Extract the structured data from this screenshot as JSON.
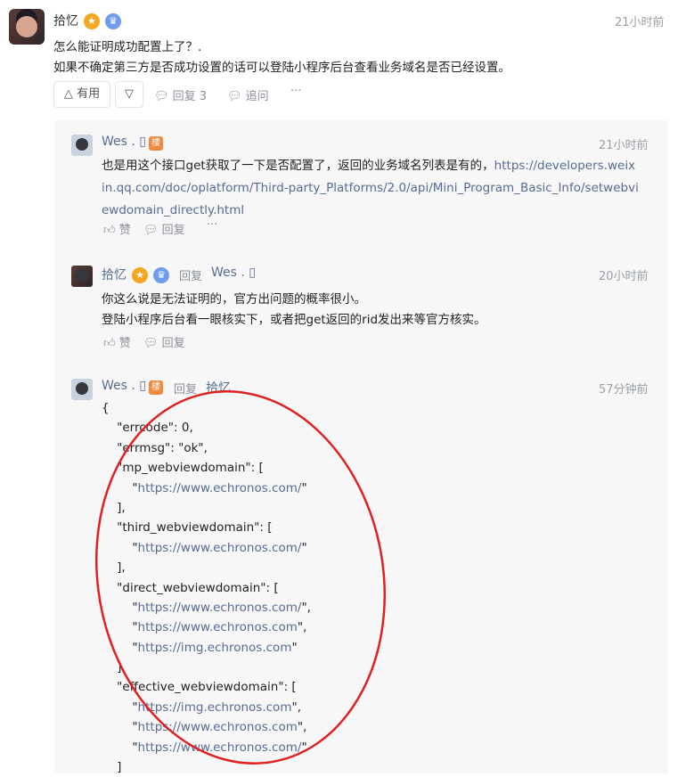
{
  "top": {
    "author": "拾忆",
    "time": "21小时前",
    "line1": "怎么能证明成功配置上了？.",
    "line2": "如果不确定第三方是否成功设置的话可以登陆小程序后台查看业务域名是否已经设置。",
    "useful_label": "有用",
    "reply_label": "回复 3",
    "followup_label": "追问",
    "more_label": "···"
  },
  "replies": [
    {
      "author": "Wes . ▯",
      "badge": "楼",
      "time": "21小时前",
      "text_prefix": "也是用这个接口get获取了一下是否配置了，返回的业务域名列表是有的，",
      "link_line1": "https://developers.weix",
      "link_line2": "in.qq.com/doc/oplatform/Third-party_Platforms/2.0/api/Mini_Program_Basic_Info/setwebvi",
      "link_line3": "ewdomain_directly.html",
      "like_label": "赞",
      "reply_label": "回复",
      "more_label": "···"
    },
    {
      "author": "拾忆",
      "reply_word": "回复",
      "reply_to": "Wes . ▯",
      "time": "20小时前",
      "line1": "你这么说是无法证明的，官方出问题的概率很小。",
      "line2": "登陆小程序后台看一眼核实下，或者把get返回的rid发出来等官方核实。",
      "like_label": "赞",
      "reply_label": "回复"
    },
    {
      "author": "Wes . ▯",
      "badge": "楼",
      "reply_word": "回复",
      "reply_to": "拾忆",
      "time": "57分钟前",
      "code_lines": [
        "{",
        "    \"errcode\": 0,",
        "    \"errmsg\": \"ok\",",
        "    \"mp_webviewdomain\": [",
        "        \"https://www.echronos.com/\"",
        "    ],",
        "    \"third_webviewdomain\": [",
        "        \"https://www.echronos.com/\"",
        "    ],",
        "    \"direct_webviewdomain\": [",
        "        \"https://www.echronos.com/\",",
        "        \"https://www.echronos.com\",",
        "        \"https://img.echronos.com\"",
        "    ],",
        "    \"effective_webviewdomain\": [",
        "        \"https://img.echronos.com\",",
        "        \"https://www.echronos.com\",",
        "        \"https://www.echronos.com/\"",
        "    ]"
      ]
    }
  ],
  "colors": {
    "link": "#576b95",
    "annotation": "#e02020",
    "gold_badge": "#f5a623",
    "blue_badge": "#6f9be8",
    "orange_badge": "#f08a3e"
  }
}
